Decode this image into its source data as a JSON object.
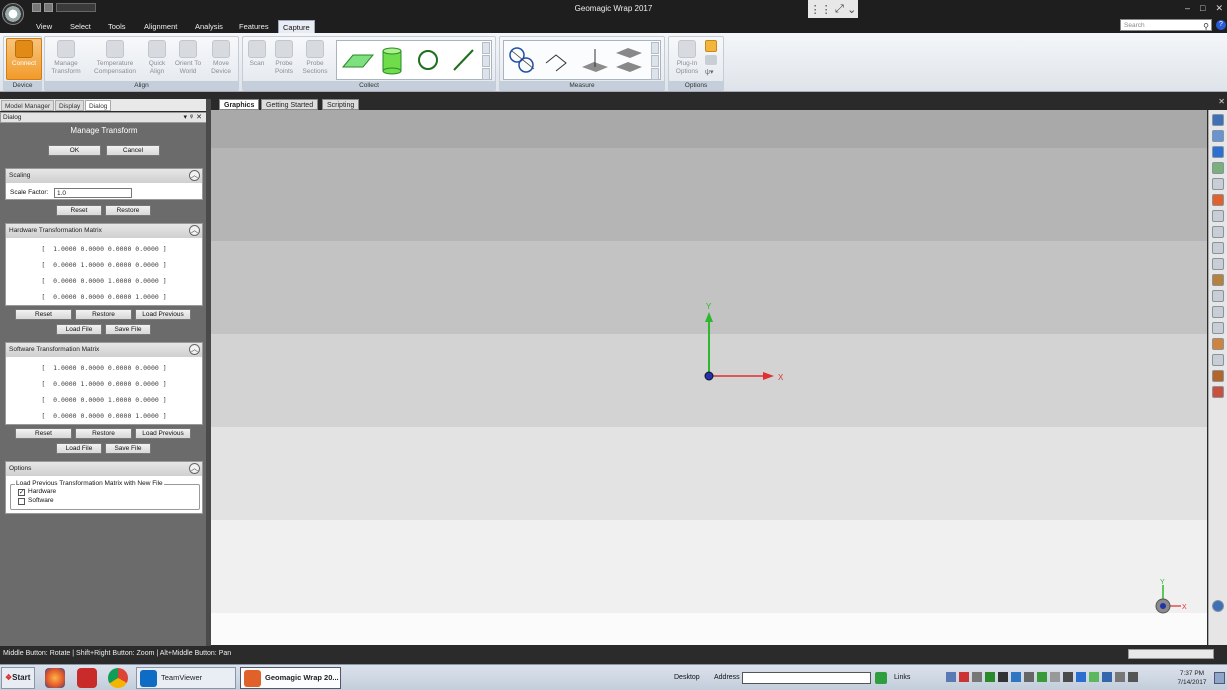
{
  "app": {
    "title": "Geomagic Wrap 2017"
  },
  "ribbon_tabs": [
    "View",
    "Select",
    "Tools",
    "Alignment",
    "Analysis",
    "Features",
    "Capture"
  ],
  "search_placeholder": "Search",
  "groups": {
    "device": {
      "label": "Device",
      "buttons": [
        "Connect"
      ]
    },
    "align": {
      "label": "Align",
      "buttons": [
        [
          "Manage",
          "Transform"
        ],
        [
          "Temperature",
          "Compensation"
        ],
        [
          "Quick",
          "Align"
        ],
        [
          "Orient To",
          "World"
        ],
        [
          "Move",
          "Device"
        ]
      ]
    },
    "collect": {
      "label": "Collect",
      "buttons": [
        [
          "Scan",
          ""
        ],
        [
          "Probe",
          "Points"
        ],
        [
          "Probe",
          "Sections"
        ]
      ]
    },
    "measure": {
      "label": "Measure"
    },
    "options": {
      "label": "Options",
      "buttons": [
        [
          "Plug-In",
          "Options"
        ]
      ]
    }
  },
  "left_tabs": [
    "Model Manager",
    "Display",
    "Dialog"
  ],
  "dialog": {
    "header": "Dialog",
    "title": "Manage Transform",
    "ok": "OK",
    "cancel": "Cancel",
    "scaling": {
      "title": "Scaling",
      "label": "Scale Factor:",
      "value": "1.0",
      "reset": "Reset",
      "restore": "Restore"
    },
    "hardware": {
      "title": "Hardware Transformation Matrix",
      "rows": [
        "[  1.0000 0.0000 0.0000 0.0000 ]",
        "[  0.0000 1.0000 0.0000 0.0000 ]",
        "[  0.0000 0.0000 1.0000 0.0000 ]",
        "[  0.0000 0.0000 0.0000 1.0000 ]"
      ],
      "reset": "Reset",
      "restore": "Restore",
      "load_previous": "Load Previous",
      "load_file": "Load File",
      "save_file": "Save File"
    },
    "software": {
      "title": "Software Transformation Matrix",
      "rows": [
        "[  1.0000 0.0000 0.0000 0.0000 ]",
        "[  0.0000 1.0000 0.0000 0.0000 ]",
        "[  0.0000 0.0000 1.0000 0.0000 ]",
        "[  0.0000 0.0000 0.0000 1.0000 ]"
      ],
      "reset": "Reset",
      "restore": "Restore",
      "load_previous": "Load Previous",
      "load_file": "Load File",
      "save_file": "Save File"
    },
    "options": {
      "title": "Options",
      "group_title": "Load Previous Transformation Matrix with New File",
      "hardware_label": "Hardware",
      "hardware_checked": true,
      "software_label": "Software",
      "software_checked": false
    }
  },
  "graphics_tabs": [
    "Graphics",
    "Getting Started",
    "Scripting"
  ],
  "axes": {
    "x": "X",
    "y": "Y"
  },
  "status": "Middle Button: Rotate | Shift+Right Button: Zoom | Alt+Middle Button: Pan",
  "taskbar": {
    "start": "Start",
    "tasks": [
      "TeamViewer",
      "Geomagic Wrap 20..."
    ],
    "desktop": "Desktop",
    "address": "Address",
    "links": "Links",
    "time": "7:37 PM",
    "date": "7/14/2017"
  },
  "colors": {
    "accent": "#f29b2b",
    "x_axis": "#e03030",
    "y_axis": "#2db82d",
    "z_axis": "#2233aa"
  }
}
